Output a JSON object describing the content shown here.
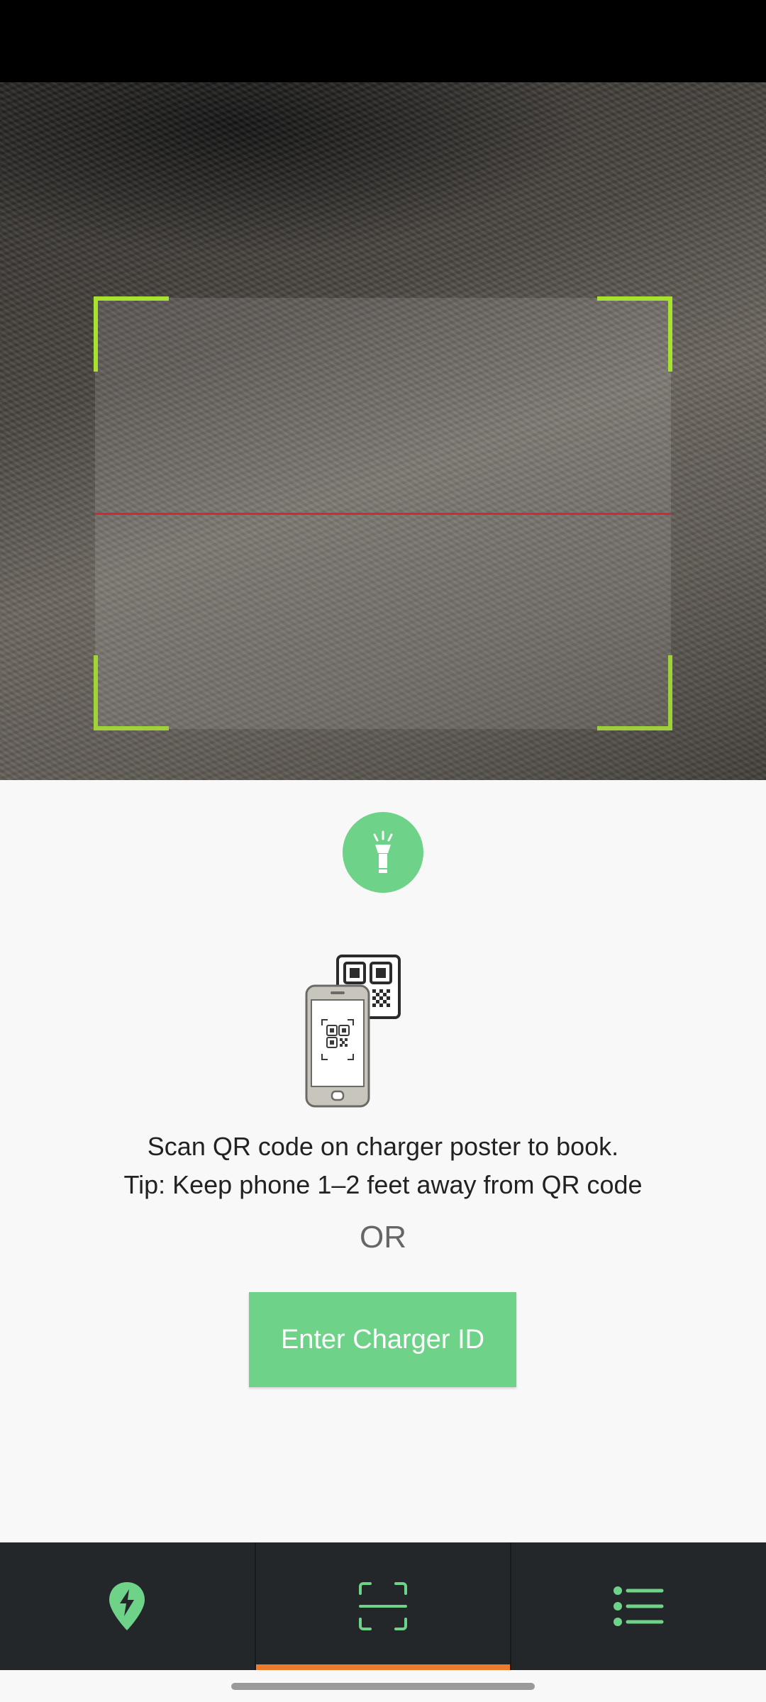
{
  "scanner": {
    "instruction_line1": "Scan QR code on charger poster to book.",
    "instruction_line2": "Tip: Keep phone 1–2 feet away from QR code",
    "or_label": "OR",
    "enter_id_label": "Enter Charger ID"
  },
  "icons": {
    "torch": "flashlight-icon",
    "illustration": "phone-scanning-qr-icon",
    "nav_map": "charger-location-pin-icon",
    "nav_scan": "scan-frame-icon",
    "nav_list": "list-icon"
  },
  "colors": {
    "accent_green": "#6fd289",
    "frame_corner": "#a6e22e",
    "scan_line": "#d9242a",
    "nav_background": "#242729",
    "active_indicator": "#f07a2c"
  },
  "bottom_nav": {
    "active_tab": "scan"
  }
}
